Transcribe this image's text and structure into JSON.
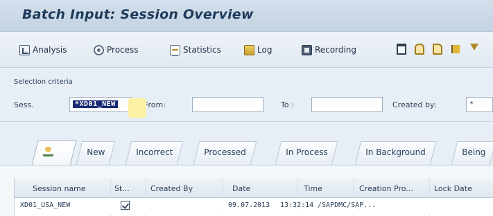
{
  "window": {
    "title": "Batch Input: Session Overview"
  },
  "toolbar": {
    "analysis_label": "Analysis",
    "process_label": "Process",
    "statistics_label": "Statistics",
    "log_label": "Log",
    "recording_label": "Recording",
    "icons": [
      "trash-icon",
      "lock-icon",
      "unlock-icon",
      "flag-icon",
      "filter-icon"
    ]
  },
  "selection": {
    "heading": "Selection criteria",
    "session_label": "Sess.",
    "session_value": "*XD01_NEW",
    "from_label": "From:",
    "from_value": "",
    "to_label": "To :",
    "to_value": "",
    "created_by_label": "Created by:",
    "created_by_value": "*"
  },
  "tabs": [
    "New",
    "Incorrect",
    "Processed",
    "In Process",
    "In Background",
    "Being"
  ],
  "table": {
    "headers": [
      "Session name",
      "St...",
      "Created By",
      "Date",
      "Time",
      "Creation Pro...",
      "Lock Date"
    ],
    "rows": [
      {
        "session_name": "XD01_USA_NEW",
        "created_by": "",
        "date": "09.07.2013",
        "time": "13:32:14",
        "creation_program": "/SAPDMC/SAP...",
        "lock_date": ""
      }
    ]
  }
}
